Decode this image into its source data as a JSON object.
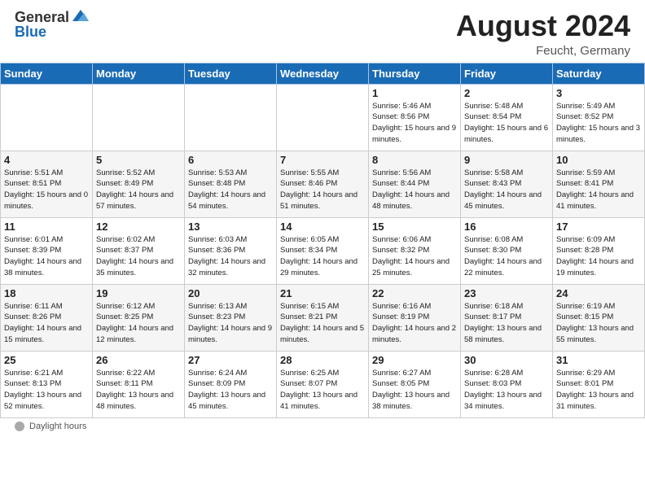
{
  "header": {
    "logo_general": "General",
    "logo_blue": "Blue",
    "month_title": "August 2024",
    "location": "Feucht, Germany"
  },
  "calendar": {
    "days_of_week": [
      "Sunday",
      "Monday",
      "Tuesday",
      "Wednesday",
      "Thursday",
      "Friday",
      "Saturday"
    ],
    "weeks": [
      [
        {
          "day": "",
          "detail": ""
        },
        {
          "day": "",
          "detail": ""
        },
        {
          "day": "",
          "detail": ""
        },
        {
          "day": "",
          "detail": ""
        },
        {
          "day": "1",
          "detail": "Sunrise: 5:46 AM\nSunset: 8:56 PM\nDaylight: 15 hours\nand 9 minutes."
        },
        {
          "day": "2",
          "detail": "Sunrise: 5:48 AM\nSunset: 8:54 PM\nDaylight: 15 hours\nand 6 minutes."
        },
        {
          "day": "3",
          "detail": "Sunrise: 5:49 AM\nSunset: 8:52 PM\nDaylight: 15 hours\nand 3 minutes."
        }
      ],
      [
        {
          "day": "4",
          "detail": "Sunrise: 5:51 AM\nSunset: 8:51 PM\nDaylight: 15 hours\nand 0 minutes."
        },
        {
          "day": "5",
          "detail": "Sunrise: 5:52 AM\nSunset: 8:49 PM\nDaylight: 14 hours\nand 57 minutes."
        },
        {
          "day": "6",
          "detail": "Sunrise: 5:53 AM\nSunset: 8:48 PM\nDaylight: 14 hours\nand 54 minutes."
        },
        {
          "day": "7",
          "detail": "Sunrise: 5:55 AM\nSunset: 8:46 PM\nDaylight: 14 hours\nand 51 minutes."
        },
        {
          "day": "8",
          "detail": "Sunrise: 5:56 AM\nSunset: 8:44 PM\nDaylight: 14 hours\nand 48 minutes."
        },
        {
          "day": "9",
          "detail": "Sunrise: 5:58 AM\nSunset: 8:43 PM\nDaylight: 14 hours\nand 45 minutes."
        },
        {
          "day": "10",
          "detail": "Sunrise: 5:59 AM\nSunset: 8:41 PM\nDaylight: 14 hours\nand 41 minutes."
        }
      ],
      [
        {
          "day": "11",
          "detail": "Sunrise: 6:01 AM\nSunset: 8:39 PM\nDaylight: 14 hours\nand 38 minutes."
        },
        {
          "day": "12",
          "detail": "Sunrise: 6:02 AM\nSunset: 8:37 PM\nDaylight: 14 hours\nand 35 minutes."
        },
        {
          "day": "13",
          "detail": "Sunrise: 6:03 AM\nSunset: 8:36 PM\nDaylight: 14 hours\nand 32 minutes."
        },
        {
          "day": "14",
          "detail": "Sunrise: 6:05 AM\nSunset: 8:34 PM\nDaylight: 14 hours\nand 29 minutes."
        },
        {
          "day": "15",
          "detail": "Sunrise: 6:06 AM\nSunset: 8:32 PM\nDaylight: 14 hours\nand 25 minutes."
        },
        {
          "day": "16",
          "detail": "Sunrise: 6:08 AM\nSunset: 8:30 PM\nDaylight: 14 hours\nand 22 minutes."
        },
        {
          "day": "17",
          "detail": "Sunrise: 6:09 AM\nSunset: 8:28 PM\nDaylight: 14 hours\nand 19 minutes."
        }
      ],
      [
        {
          "day": "18",
          "detail": "Sunrise: 6:11 AM\nSunset: 8:26 PM\nDaylight: 14 hours\nand 15 minutes."
        },
        {
          "day": "19",
          "detail": "Sunrise: 6:12 AM\nSunset: 8:25 PM\nDaylight: 14 hours\nand 12 minutes."
        },
        {
          "day": "20",
          "detail": "Sunrise: 6:13 AM\nSunset: 8:23 PM\nDaylight: 14 hours\nand 9 minutes."
        },
        {
          "day": "21",
          "detail": "Sunrise: 6:15 AM\nSunset: 8:21 PM\nDaylight: 14 hours\nand 5 minutes."
        },
        {
          "day": "22",
          "detail": "Sunrise: 6:16 AM\nSunset: 8:19 PM\nDaylight: 14 hours\nand 2 minutes."
        },
        {
          "day": "23",
          "detail": "Sunrise: 6:18 AM\nSunset: 8:17 PM\nDaylight: 13 hours\nand 58 minutes."
        },
        {
          "day": "24",
          "detail": "Sunrise: 6:19 AM\nSunset: 8:15 PM\nDaylight: 13 hours\nand 55 minutes."
        }
      ],
      [
        {
          "day": "25",
          "detail": "Sunrise: 6:21 AM\nSunset: 8:13 PM\nDaylight: 13 hours\nand 52 minutes."
        },
        {
          "day": "26",
          "detail": "Sunrise: 6:22 AM\nSunset: 8:11 PM\nDaylight: 13 hours\nand 48 minutes."
        },
        {
          "day": "27",
          "detail": "Sunrise: 6:24 AM\nSunset: 8:09 PM\nDaylight: 13 hours\nand 45 minutes."
        },
        {
          "day": "28",
          "detail": "Sunrise: 6:25 AM\nSunset: 8:07 PM\nDaylight: 13 hours\nand 41 minutes."
        },
        {
          "day": "29",
          "detail": "Sunrise: 6:27 AM\nSunset: 8:05 PM\nDaylight: 13 hours\nand 38 minutes."
        },
        {
          "day": "30",
          "detail": "Sunrise: 6:28 AM\nSunset: 8:03 PM\nDaylight: 13 hours\nand 34 minutes."
        },
        {
          "day": "31",
          "detail": "Sunrise: 6:29 AM\nSunset: 8:01 PM\nDaylight: 13 hours\nand 31 minutes."
        }
      ]
    ]
  },
  "footer": {
    "daylight_label": "Daylight hours"
  }
}
